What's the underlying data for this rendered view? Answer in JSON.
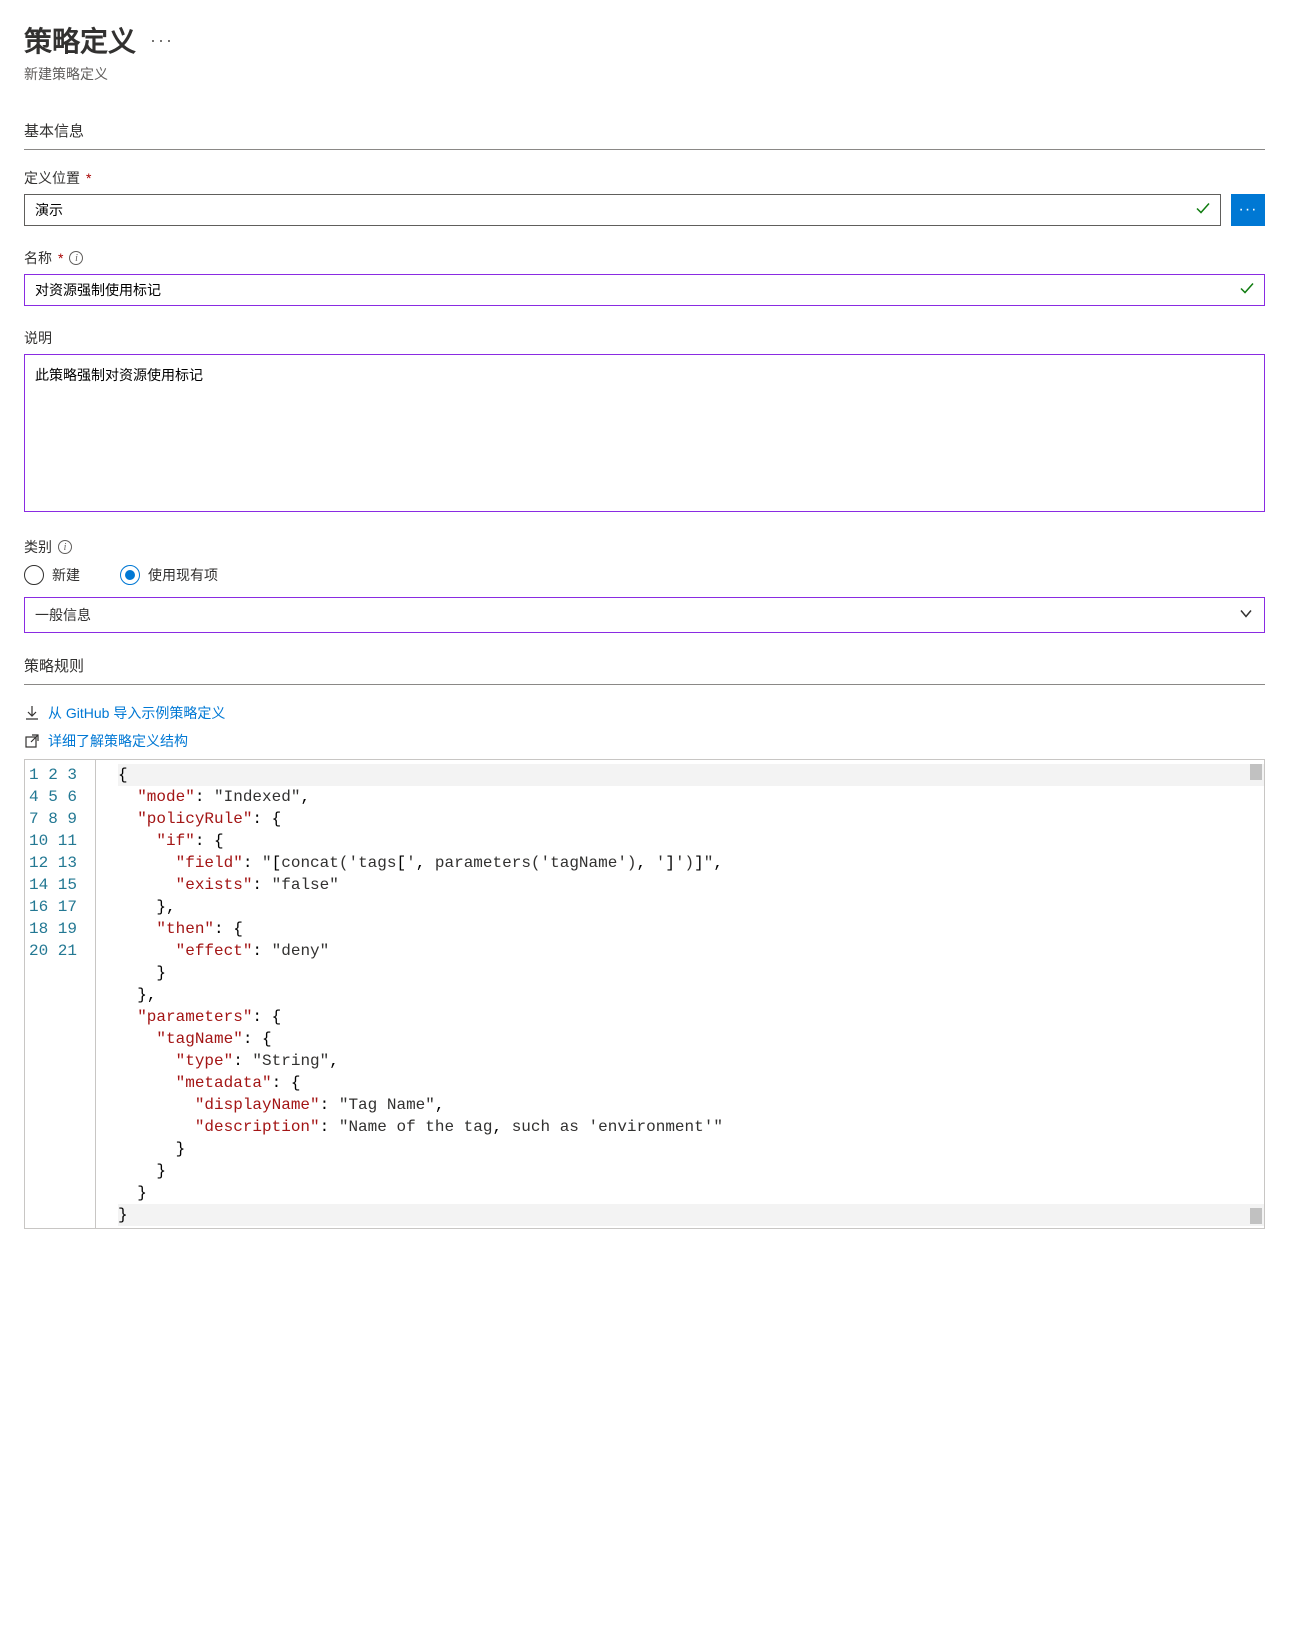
{
  "header": {
    "title": "策略定义",
    "subtitle": "新建策略定义"
  },
  "sections": {
    "basic": "基本信息",
    "rule": "策略规则"
  },
  "fields": {
    "location": {
      "label": "定义位置",
      "value": "演示"
    },
    "name": {
      "label": "名称",
      "value": "对资源强制使用标记"
    },
    "description": {
      "label": "说明",
      "value": "此策略强制对资源使用标记"
    },
    "category": {
      "label": "类别",
      "options": {
        "new": "新建",
        "existing": "使用现有项"
      },
      "selected": "一般信息"
    }
  },
  "links": {
    "github": "从 GitHub 导入示例策略定义",
    "learn": "详细了解策略定义结构"
  },
  "code_lines": [
    "{",
    "  \"mode\": \"Indexed\",",
    "  \"policyRule\": {",
    "    \"if\": {",
    "      \"field\": \"[concat('tags[', parameters('tagName'), ']')]\",",
    "      \"exists\": \"false\"",
    "    },",
    "    \"then\": {",
    "      \"effect\": \"deny\"",
    "    }",
    "  },",
    "  \"parameters\": {",
    "    \"tagName\": {",
    "      \"type\": \"String\",",
    "      \"metadata\": {",
    "        \"displayName\": \"Tag Name\",",
    "        \"description\": \"Name of the tag, such as 'environment'\"",
    "      }",
    "    }",
    "  }",
    "}"
  ]
}
